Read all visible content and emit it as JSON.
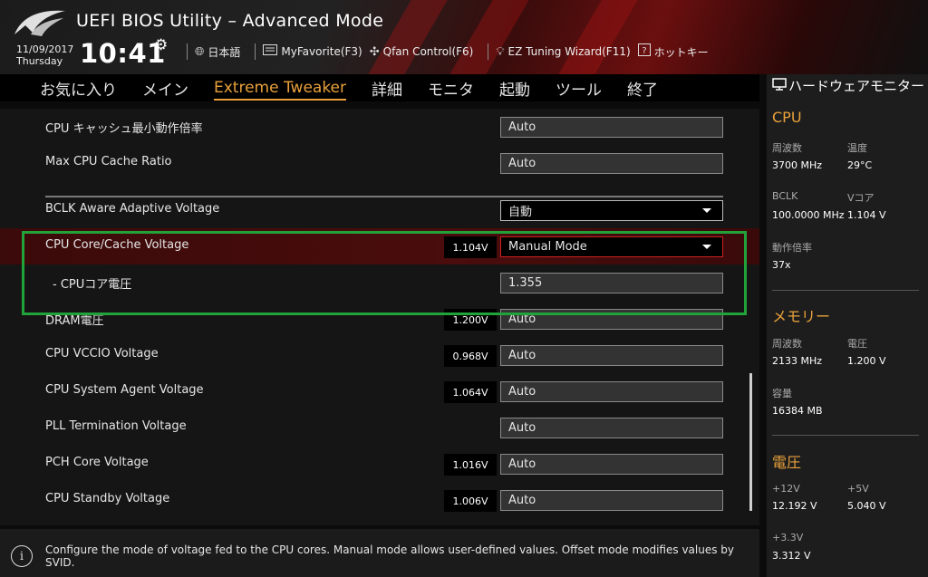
{
  "header": {
    "title": "UEFI BIOS Utility – Advanced Mode",
    "date": "11/09/2017",
    "weekday": "Thursday",
    "time": "10:41",
    "toolbar": [
      {
        "icon": "globe-icon",
        "label": "日本語"
      },
      {
        "icon": "star-list-icon",
        "label": "MyFavorite(F3)"
      },
      {
        "icon": "fan-icon",
        "label": "Qfan Control(F6)"
      },
      {
        "icon": "bulb-icon",
        "label": "EZ Tuning Wizard(F11)"
      },
      {
        "icon": "question-icon",
        "label": "ホットキー"
      }
    ]
  },
  "menu": {
    "tabs": [
      "お気に入り",
      "メイン",
      "Extreme Tweaker",
      "詳細",
      "モニタ",
      "起動",
      "ツール",
      "終了"
    ],
    "active_index": 2
  },
  "settings": [
    {
      "label": "CPU キャッシュ最小動作倍率",
      "reading": "",
      "value": "Auto",
      "kind": "text"
    },
    {
      "label": "Max CPU Cache Ratio",
      "reading": "",
      "value": "Auto",
      "kind": "text"
    },
    {
      "label": "BCLK Aware Adaptive Voltage",
      "reading": "",
      "value": "自動",
      "kind": "dropdown"
    },
    {
      "label": "CPU Core/Cache Voltage",
      "reading": "1.104V",
      "value": "Manual Mode",
      "kind": "dropdown-selected"
    },
    {
      "label": "- CPUコア電圧",
      "reading": "",
      "value": "1.355",
      "kind": "text"
    },
    {
      "label": "DRAM電圧",
      "reading": "1.200V",
      "value": "Auto",
      "kind": "text"
    },
    {
      "label": "CPU VCCIO Voltage",
      "reading": "0.968V",
      "value": "Auto",
      "kind": "text"
    },
    {
      "label": "CPU System Agent Voltage",
      "reading": "1.064V",
      "value": "Auto",
      "kind": "text"
    },
    {
      "label": "PLL Termination Voltage",
      "reading": "",
      "value": "Auto",
      "kind": "text"
    },
    {
      "label": "PCH Core Voltage",
      "reading": "1.016V",
      "value": "Auto",
      "kind": "text"
    },
    {
      "label": "CPU Standby Voltage",
      "reading": "1.006V",
      "value": "Auto",
      "kind": "text"
    }
  ],
  "help": {
    "text": "Configure the mode of voltage fed to the CPU cores. Manual mode allows user-defined values. Offset mode modifies values by SVID."
  },
  "hw_monitor": {
    "title": "ハードウェアモニター",
    "cpu": {
      "heading": "CPU",
      "freq_label": "周波数",
      "freq": "3700 MHz",
      "temp_label": "温度",
      "temp": "29°C",
      "bclk_label": "BCLK",
      "bclk": "100.0000 MHz",
      "vcore_label": "Vコア",
      "vcore": "1.104 V",
      "ratio_label": "動作倍率",
      "ratio": "37x"
    },
    "memory": {
      "heading": "メモリー",
      "freq_label": "周波数",
      "freq": "2133 MHz",
      "volt_label": "電圧",
      "volt": "1.200 V",
      "cap_label": "容量",
      "cap": "16384 MB"
    },
    "voltage": {
      "heading": "電圧",
      "v12_label": "+12V",
      "v12": "12.192 V",
      "v5_label": "+5V",
      "v5": "5.040 V",
      "v33_label": "+3.3V",
      "v33": "3.312 V"
    }
  },
  "colors": {
    "accent": "#e9a13b",
    "selected_row": "#4a0c0c",
    "highlight_frame": "#22a33a"
  }
}
